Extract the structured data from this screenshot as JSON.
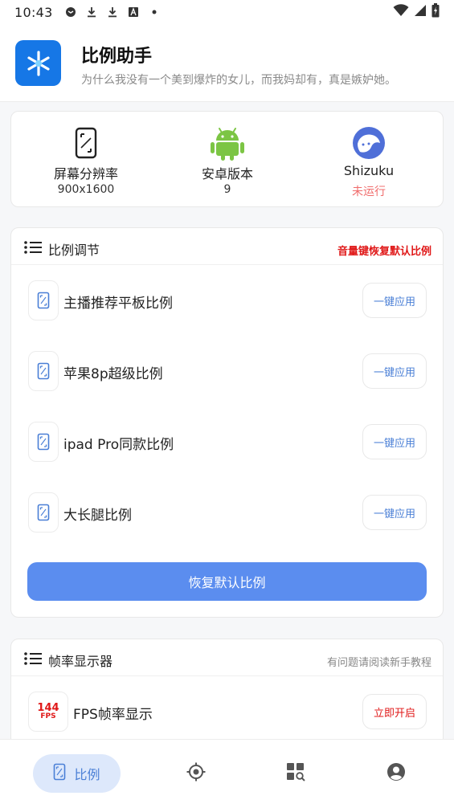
{
  "status_bar": {
    "time": "10:43",
    "icons": [
      "mail-icon",
      "download-icon",
      "download-icon",
      "font-icon",
      "dot-icon"
    ],
    "right_icons": [
      "wifi-icon",
      "signal-icon",
      "battery-charging-icon"
    ]
  },
  "header": {
    "title": "比例助手",
    "subtitle": "为什么我没有一个美到爆炸的女儿，而我妈却有，真是嫉妒她。"
  },
  "info": {
    "items": [
      {
        "label": "屏幕分辨率",
        "value": "900x1600",
        "icon": "screen-resolution-icon"
      },
      {
        "label": "安卓版本",
        "value": "9",
        "icon": "android-icon"
      },
      {
        "label": "Shizuku",
        "value": "未运行",
        "icon": "shizuku-icon"
      }
    ]
  },
  "ratio_section": {
    "title": "比例调节",
    "hint": "音量键恢复默认比例",
    "items": [
      {
        "label": "主播推荐平板比例",
        "button": "一键应用"
      },
      {
        "label": "苹果8p超级比例",
        "button": "一键应用"
      },
      {
        "label": "ipad Pro同款比例",
        "button": "一键应用"
      },
      {
        "label": "大长腿比例",
        "button": "一键应用"
      }
    ],
    "reset_button": "恢复默认比例"
  },
  "fps_section": {
    "title": "帧率显示器",
    "hint": "有问题请阅读新手教程",
    "badge_top": "144",
    "badge_bottom": "FPS",
    "items": [
      {
        "label": "FPS帧率显示",
        "button": "立即开启"
      }
    ]
  },
  "bottom_nav": {
    "items": [
      {
        "label": "比例",
        "icon": "phone-ratio-icon",
        "active": true
      },
      {
        "label": "",
        "icon": "crosshair-icon"
      },
      {
        "label": "",
        "icon": "apps-search-icon"
      },
      {
        "label": "",
        "icon": "profile-icon"
      }
    ]
  },
  "colors": {
    "accent": "#5b8def",
    "logo": "#1677e6",
    "warning": "#e01818",
    "inactive_status": "#f06c6c",
    "android": "#7cc544"
  }
}
